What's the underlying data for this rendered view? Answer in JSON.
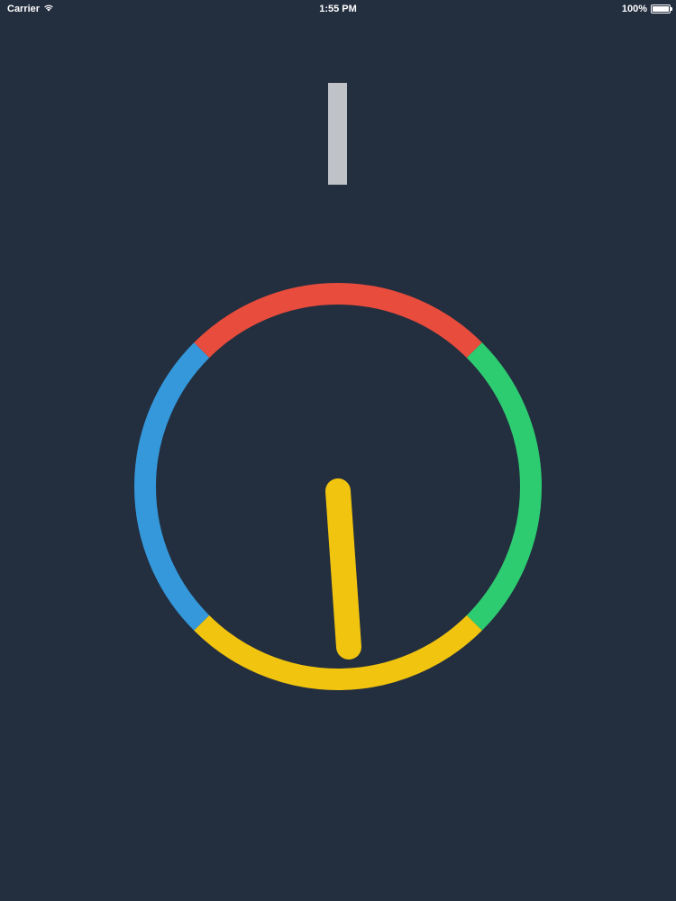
{
  "status_bar": {
    "carrier": "Carrier",
    "wifi_icon": "wifi-icon",
    "time": "1:55 PM",
    "battery_level": "100%",
    "battery_icon": "battery-icon",
    "battery_fraction": 1.0
  },
  "game": {
    "background_color": "#232e3f",
    "score_marker_color": "#bfc3c8",
    "ring": {
      "segments": [
        {
          "name": "red",
          "color": "#e74c3c"
        },
        {
          "name": "green",
          "color": "#2ecc71"
        },
        {
          "name": "yellow",
          "color": "#f1c40f"
        },
        {
          "name": "blue",
          "color": "#3498db"
        }
      ]
    },
    "player_ball": {
      "color": "#f1c40f"
    }
  }
}
